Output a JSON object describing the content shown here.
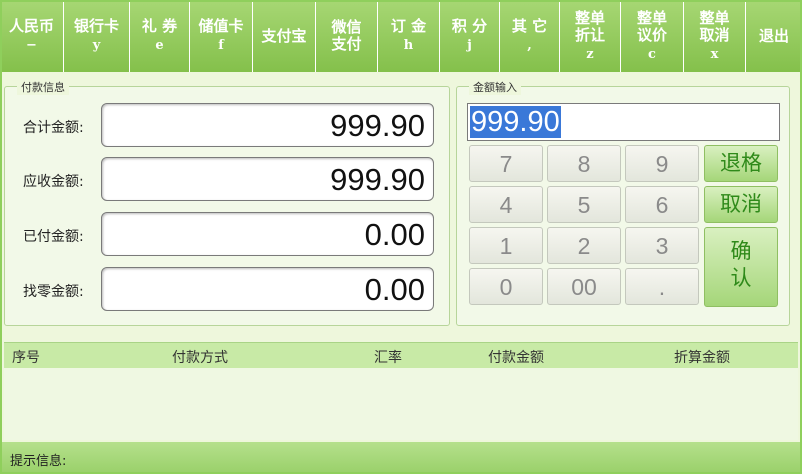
{
  "toolbar": {
    "buttons": [
      {
        "name": "cash-button",
        "line1": "人民币",
        "line2": "",
        "key": "−",
        "width": 64
      },
      {
        "name": "bank-card-button",
        "line1": "银行卡",
        "line2": "",
        "key": "y",
        "width": 66
      },
      {
        "name": "coupon-button",
        "line1": "礼 券",
        "line2": "",
        "key": "e",
        "width": 60
      },
      {
        "name": "stored-value-card-button",
        "line1": "储值卡",
        "line2": "",
        "key": "f",
        "width": 63
      },
      {
        "name": "alipay-button",
        "line1": "支付宝",
        "line2": "",
        "key": "",
        "width": 63
      },
      {
        "name": "wechat-pay-button",
        "line1": "微信",
        "line2": "支付",
        "key": "",
        "width": 62
      },
      {
        "name": "deposit-button",
        "line1": "订 金",
        "line2": "",
        "key": "h",
        "width": 62
      },
      {
        "name": "points-button",
        "line1": "积 分",
        "line2": "",
        "key": "j",
        "width": 60
      },
      {
        "name": "other-button",
        "line1": "其 它",
        "line2": "",
        "key": ",",
        "width": 60
      },
      {
        "name": "order-discount-button",
        "line1": "整单",
        "line2": "折让",
        "key": "z",
        "width": 61
      },
      {
        "name": "order-bargain-button",
        "line1": "整单",
        "line2": "议价",
        "key": "c",
        "width": 63
      },
      {
        "name": "order-cancel-button",
        "line1": "整单",
        "line2": "取消",
        "key": "x",
        "width": 62
      },
      {
        "name": "exit-button",
        "line1": "退出",
        "line2": "",
        "key": "",
        "width": 56
      }
    ]
  },
  "payment": {
    "title": "付款信息",
    "total_label": "合计金额:",
    "total_value": "999.90",
    "receivable_label": "应收金额:",
    "receivable_value": "999.90",
    "paid_label": "已付金额:",
    "paid_value": "0.00",
    "change_label": "找零金额:",
    "change_value": "0.00"
  },
  "amount": {
    "title": "金额输入",
    "input_value": "999.90"
  },
  "keypad": {
    "k7": "7",
    "k8": "8",
    "k9": "9",
    "k4": "4",
    "k5": "5",
    "k6": "6",
    "k1": "1",
    "k2": "2",
    "k3": "3",
    "k0": "0",
    "k00": "00",
    "kdot": ".",
    "backspace": "退格",
    "cancel": "取消",
    "confirm_line1": "确",
    "confirm_line2": "认"
  },
  "table": {
    "columns": [
      "序号",
      "付款方式",
      "汇率",
      "付款金额",
      "折算金额"
    ]
  },
  "status": {
    "label": "提示信息:"
  }
}
